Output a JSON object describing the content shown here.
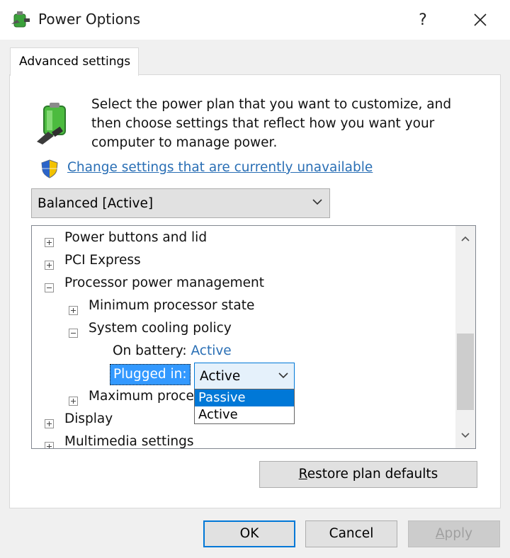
{
  "window": {
    "title": "Power Options",
    "help_label": "?",
    "close_icon": "close-icon",
    "app_icon": "power-options-icon"
  },
  "tabs": [
    {
      "label": "Advanced settings",
      "active": true
    }
  ],
  "panel": {
    "description": "Select the power plan that you want to customize, and then choose settings that reflect how you want your computer to manage power.",
    "change_settings_link": "Change settings that are currently unavailable",
    "plan_select": {
      "value": "Balanced [Active]"
    }
  },
  "tree": {
    "items": [
      {
        "label": "Power buttons and lid",
        "expander": "plus"
      },
      {
        "label": "PCI Express",
        "expander": "plus"
      },
      {
        "label": "Processor power management",
        "expander": "minus"
      },
      {
        "label": "Minimum processor state",
        "expander": "plus"
      },
      {
        "label": "System cooling policy",
        "expander": "minus"
      },
      {
        "label": "On battery:",
        "value": "Active"
      },
      {
        "label": "Plugged in:",
        "value": "Active"
      },
      {
        "label": "Maximum processor state",
        "visible_text": "Maximum proce",
        "expander": "plus"
      },
      {
        "label": "Display",
        "expander": "plus"
      },
      {
        "label": "Multimedia settings",
        "expander": "plus"
      }
    ],
    "dropdown": {
      "current": "Active",
      "options": [
        "Passive",
        "Active"
      ],
      "highlighted": "Passive"
    }
  },
  "buttons": {
    "restore_prefix": "",
    "restore_accel": "R",
    "restore_rest": "estore plan defaults",
    "ok": "OK",
    "cancel": "Cancel",
    "apply_accel": "A",
    "apply_rest": "pply"
  },
  "colors": {
    "link": "#2a6fb5",
    "selection": "#3399ff",
    "accent": "#0078d7"
  }
}
